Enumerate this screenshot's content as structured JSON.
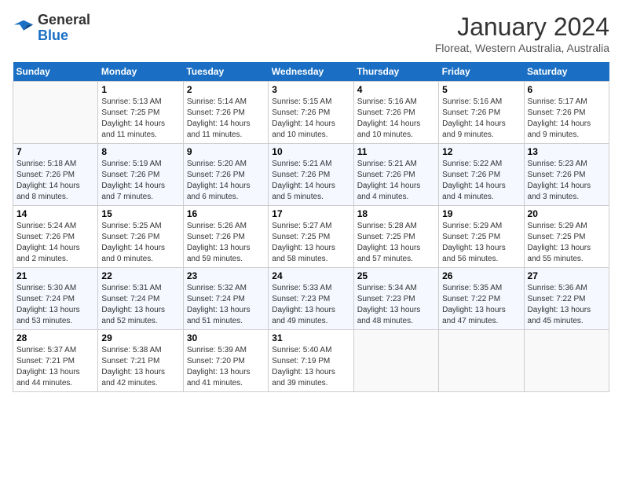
{
  "header": {
    "logo_general": "General",
    "logo_blue": "Blue",
    "month_year": "January 2024",
    "location": "Floreat, Western Australia, Australia"
  },
  "calendar": {
    "days_of_week": [
      "Sunday",
      "Monday",
      "Tuesday",
      "Wednesday",
      "Thursday",
      "Friday",
      "Saturday"
    ],
    "weeks": [
      [
        {
          "day": "",
          "info": ""
        },
        {
          "day": "1",
          "info": "Sunrise: 5:13 AM\nSunset: 7:25 PM\nDaylight: 14 hours\nand 11 minutes."
        },
        {
          "day": "2",
          "info": "Sunrise: 5:14 AM\nSunset: 7:26 PM\nDaylight: 14 hours\nand 11 minutes."
        },
        {
          "day": "3",
          "info": "Sunrise: 5:15 AM\nSunset: 7:26 PM\nDaylight: 14 hours\nand 10 minutes."
        },
        {
          "day": "4",
          "info": "Sunrise: 5:16 AM\nSunset: 7:26 PM\nDaylight: 14 hours\nand 10 minutes."
        },
        {
          "day": "5",
          "info": "Sunrise: 5:16 AM\nSunset: 7:26 PM\nDaylight: 14 hours\nand 9 minutes."
        },
        {
          "day": "6",
          "info": "Sunrise: 5:17 AM\nSunset: 7:26 PM\nDaylight: 14 hours\nand 9 minutes."
        }
      ],
      [
        {
          "day": "7",
          "info": "Sunrise: 5:18 AM\nSunset: 7:26 PM\nDaylight: 14 hours\nand 8 minutes."
        },
        {
          "day": "8",
          "info": "Sunrise: 5:19 AM\nSunset: 7:26 PM\nDaylight: 14 hours\nand 7 minutes."
        },
        {
          "day": "9",
          "info": "Sunrise: 5:20 AM\nSunset: 7:26 PM\nDaylight: 14 hours\nand 6 minutes."
        },
        {
          "day": "10",
          "info": "Sunrise: 5:21 AM\nSunset: 7:26 PM\nDaylight: 14 hours\nand 5 minutes."
        },
        {
          "day": "11",
          "info": "Sunrise: 5:21 AM\nSunset: 7:26 PM\nDaylight: 14 hours\nand 4 minutes."
        },
        {
          "day": "12",
          "info": "Sunrise: 5:22 AM\nSunset: 7:26 PM\nDaylight: 14 hours\nand 4 minutes."
        },
        {
          "day": "13",
          "info": "Sunrise: 5:23 AM\nSunset: 7:26 PM\nDaylight: 14 hours\nand 3 minutes."
        }
      ],
      [
        {
          "day": "14",
          "info": "Sunrise: 5:24 AM\nSunset: 7:26 PM\nDaylight: 14 hours\nand 2 minutes."
        },
        {
          "day": "15",
          "info": "Sunrise: 5:25 AM\nSunset: 7:26 PM\nDaylight: 14 hours\nand 0 minutes."
        },
        {
          "day": "16",
          "info": "Sunrise: 5:26 AM\nSunset: 7:26 PM\nDaylight: 13 hours\nand 59 minutes."
        },
        {
          "day": "17",
          "info": "Sunrise: 5:27 AM\nSunset: 7:25 PM\nDaylight: 13 hours\nand 58 minutes."
        },
        {
          "day": "18",
          "info": "Sunrise: 5:28 AM\nSunset: 7:25 PM\nDaylight: 13 hours\nand 57 minutes."
        },
        {
          "day": "19",
          "info": "Sunrise: 5:29 AM\nSunset: 7:25 PM\nDaylight: 13 hours\nand 56 minutes."
        },
        {
          "day": "20",
          "info": "Sunrise: 5:29 AM\nSunset: 7:25 PM\nDaylight: 13 hours\nand 55 minutes."
        }
      ],
      [
        {
          "day": "21",
          "info": "Sunrise: 5:30 AM\nSunset: 7:24 PM\nDaylight: 13 hours\nand 53 minutes."
        },
        {
          "day": "22",
          "info": "Sunrise: 5:31 AM\nSunset: 7:24 PM\nDaylight: 13 hours\nand 52 minutes."
        },
        {
          "day": "23",
          "info": "Sunrise: 5:32 AM\nSunset: 7:24 PM\nDaylight: 13 hours\nand 51 minutes."
        },
        {
          "day": "24",
          "info": "Sunrise: 5:33 AM\nSunset: 7:23 PM\nDaylight: 13 hours\nand 49 minutes."
        },
        {
          "day": "25",
          "info": "Sunrise: 5:34 AM\nSunset: 7:23 PM\nDaylight: 13 hours\nand 48 minutes."
        },
        {
          "day": "26",
          "info": "Sunrise: 5:35 AM\nSunset: 7:22 PM\nDaylight: 13 hours\nand 47 minutes."
        },
        {
          "day": "27",
          "info": "Sunrise: 5:36 AM\nSunset: 7:22 PM\nDaylight: 13 hours\nand 45 minutes."
        }
      ],
      [
        {
          "day": "28",
          "info": "Sunrise: 5:37 AM\nSunset: 7:21 PM\nDaylight: 13 hours\nand 44 minutes."
        },
        {
          "day": "29",
          "info": "Sunrise: 5:38 AM\nSunset: 7:21 PM\nDaylight: 13 hours\nand 42 minutes."
        },
        {
          "day": "30",
          "info": "Sunrise: 5:39 AM\nSunset: 7:20 PM\nDaylight: 13 hours\nand 41 minutes."
        },
        {
          "day": "31",
          "info": "Sunrise: 5:40 AM\nSunset: 7:19 PM\nDaylight: 13 hours\nand 39 minutes."
        },
        {
          "day": "",
          "info": ""
        },
        {
          "day": "",
          "info": ""
        },
        {
          "day": "",
          "info": ""
        }
      ]
    ]
  }
}
